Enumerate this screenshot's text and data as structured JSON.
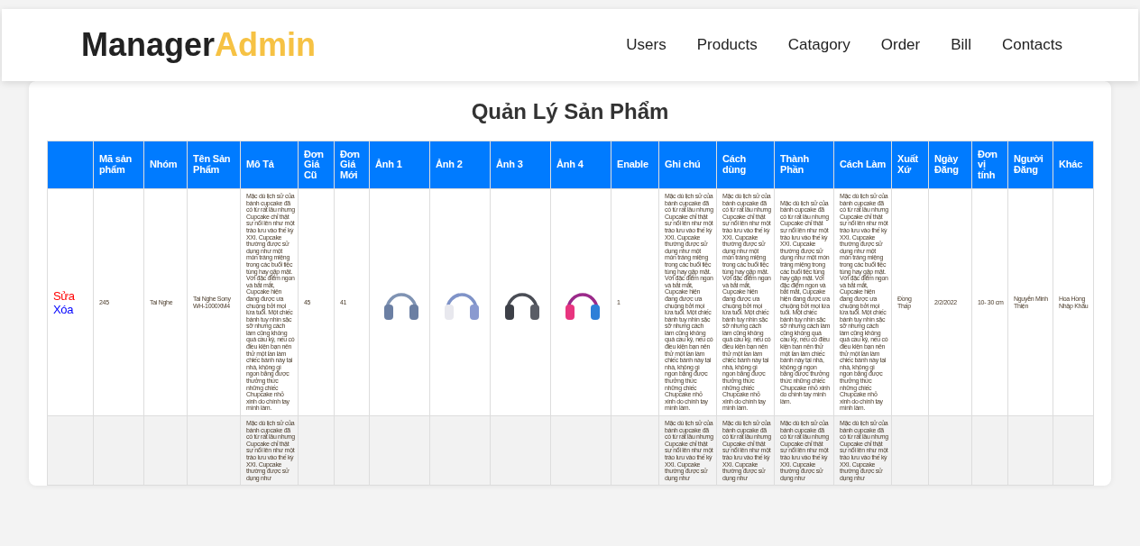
{
  "navbar": {
    "logo_main": "Manager",
    "logo_accent": "Admin",
    "links": [
      "Users",
      "Products",
      "Catagory",
      "Order",
      "Bill",
      "Contacts"
    ]
  },
  "page_title": "Quản Lý Sản Phẩm",
  "table": {
    "columns": [
      {
        "kind": "actions"
      },
      {
        "label": "Mã sản phẩm",
        "kind": "text"
      },
      {
        "label": "Nhóm",
        "kind": "text"
      },
      {
        "label": "Tên Sản Phẩm",
        "kind": "text"
      },
      {
        "label": "Mô Tả",
        "kind": "text"
      },
      {
        "label": "Đơn Giá Cũ",
        "kind": "text"
      },
      {
        "label": "Đơn Giá Mới",
        "kind": "text"
      },
      {
        "label": "Ảnh 1",
        "kind": "image"
      },
      {
        "label": "Ảnh 2",
        "kind": "image"
      },
      {
        "label": "Ảnh 3",
        "kind": "image"
      },
      {
        "label": "Ảnh 4",
        "kind": "image"
      },
      {
        "label": "Enable",
        "kind": "text"
      },
      {
        "label": "Ghi chú",
        "kind": "text"
      },
      {
        "label": "Cách dùng",
        "kind": "text"
      },
      {
        "label": "Thành Phần",
        "kind": "text"
      },
      {
        "label": "Cách Làm",
        "kind": "text"
      },
      {
        "label": "Xuất Xứ",
        "kind": "text"
      },
      {
        "label": "Ngày Đăng",
        "kind": "text"
      },
      {
        "label": "Đơn vị tính",
        "kind": "text"
      },
      {
        "label": "Người Đăng",
        "kind": "text"
      },
      {
        "label": "Khác",
        "kind": "text"
      }
    ],
    "rows": [
      {
        "actions": [
          {
            "label": "Sửa",
            "kind": "edit"
          },
          {
            "label": "Xóa",
            "kind": "delete"
          }
        ],
        "cells": [
          null,
          "245",
          "Tai Nghe",
          "Tai Nghe Sony WH-1000XM4",
          "Mặc dù lịch sử của bánh cupcake đã có từ rất lâu nhưng Cupcake chỉ thật sự nổi lên như một trào lưu vào thế kỷ XXI. Cupcake thường được sử dụng như một món tráng miệng trong các buổi tiệc tùng hay gặp mặt. Với đặc điểm ngon và bắt mắt, Cupcake hiện đang được ưa chuộng bởi mọi lứa tuổi. Một chiếc bánh tuy nhìn sặc sỡ nhưng cách làm cũng không quá cầu kỳ, nếu có điều kiện bạn nên thử một lần làm chiếc bánh này tại nhà, không gì ngon bằng được thưởng thức những chiếc Chupcake nhỏ xinh do chính tay mình làm.",
          "45",
          "41",
          {
            "photo": true
          },
          {
            "photo": true
          },
          {
            "photo": true
          },
          {
            "photo": true
          },
          "1",
          "Mặc dù lịch sử của bánh cupcake đã có từ rất lâu nhưng Cupcake chỉ thật sự nổi lên như một trào lưu vào thế kỷ XXI. Cupcake thường được sử dụng như một món tráng miệng trong các buổi tiệc tùng hay gặp mặt. Với đặc điểm ngon và bắt mắt, Cupcake hiện đang được ưa chuộng bởi mọi lứa tuổi. Một chiếc bánh tuy nhìn sặc sỡ nhưng cách làm cũng không quá cầu kỳ, nếu có điều kiện bạn nên thử một lần làm chiếc bánh này tại nhà, không gì ngon bằng được thưởng thức những chiếc Chupcake nhỏ xinh do chính tay mình làm.",
          "Mặc dù lịch sử của bánh cupcake đã có từ rất lâu nhưng Cupcake chỉ thật sự nổi lên như một trào lưu vào thế kỷ XXI. Cupcake thường được sử dụng như một món tráng miệng trong các buổi tiệc tùng hay gặp mặt. Với đặc điểm ngon và bắt mắt, Cupcake hiện đang được ưa chuộng bởi mọi lứa tuổi. Một chiếc bánh tuy nhìn sặc sỡ nhưng cách làm cũng không quá cầu kỳ, nếu có điều kiện bạn nên thử một lần làm chiếc bánh này tại nhà, không gì ngon bằng được thưởng thức những chiếc Chupcake nhỏ xinh do chính tay mình làm.",
          "Mặc dù lịch sử của bánh cupcake đã có từ rất lâu nhưng Cupcake chỉ thật sự nổi lên như một trào lưu vào thế kỷ XXI. Cupcake thường được sử dụng như một món tráng miệng trong các buổi tiệc tùng hay gặp mặt. Với đặc điểm ngon và bắt mắt, Cupcake hiện đang được ưa chuộng bởi mọi lứa tuổi. Một chiếc bánh tuy nhìn sặc sỡ nhưng cách làm cũng không quá cầu kỳ, nếu có điều kiện bạn nên thử một lần làm chiếc bánh này tại nhà, không gì ngon bằng được thưởng thức những chiếc Chupcake nhỏ xinh do chính tay mình làm.",
          "Mặc dù lịch sử của bánh cupcake đã có từ rất lâu nhưng Cupcake chỉ thật sự nổi lên như một trào lưu vào thế kỷ XXI. Cupcake thường được sử dụng như một món tráng miệng trong các buổi tiệc tùng hay gặp mặt. Với đặc điểm ngon và bắt mắt, Cupcake hiện đang được ưa chuộng bởi mọi lứa tuổi. Một chiếc bánh tuy nhìn sặc sỡ nhưng cách làm cũng không quá cầu kỳ, nếu có điều kiện bạn nên thử một lần làm chiếc bánh này tại nhà, không gì ngon bằng được thưởng thức những chiếc Chupcake nhỏ xinh do chính tay mình làm.",
          "Đồng Thấp",
          "2/2/2022",
          "10- 30 cm",
          "Nguyễn Minh Thiện",
          "Hoa Hồng Nhập Khẩu"
        ]
      },
      {
        "actions": [],
        "cells": [
          null,
          null,
          null,
          null,
          "Mặc dù lịch sử của bánh cupcake đã có từ rất lâu nhưng Cupcake chỉ thật sự nổi lên như một trào lưu vào thế kỷ XXI. Cupcake thường được sử dụng như",
          null,
          null,
          null,
          null,
          null,
          null,
          null,
          "Mặc dù lịch sử của bánh cupcake đã có từ rất lâu nhưng Cupcake chỉ thật sự nổi lên như một trào lưu vào thế kỷ XXI. Cupcake thường được sử dụng như",
          "Mặc dù lịch sử của bánh cupcake đã có từ rất lâu nhưng Cupcake chỉ thật sự nổi lên như một trào lưu vào thế kỷ XXI. Cupcake thường được sử dụng như",
          "Mặc dù lịch sử của bánh cupcake đã có từ rất lâu nhưng Cupcake chỉ thật sự nổi lên như một trào lưu vào thế kỷ XXI. Cupcake thường được sử dụng như",
          "Mặc dù lịch sử của bánh cupcake đã có từ rất lâu nhưng Cupcake chỉ thật sự nổi lên như một trào lưu vào thế kỷ XXI. Cupcake thường được sử dụng như",
          null,
          null,
          null,
          null,
          null
        ]
      }
    ]
  }
}
